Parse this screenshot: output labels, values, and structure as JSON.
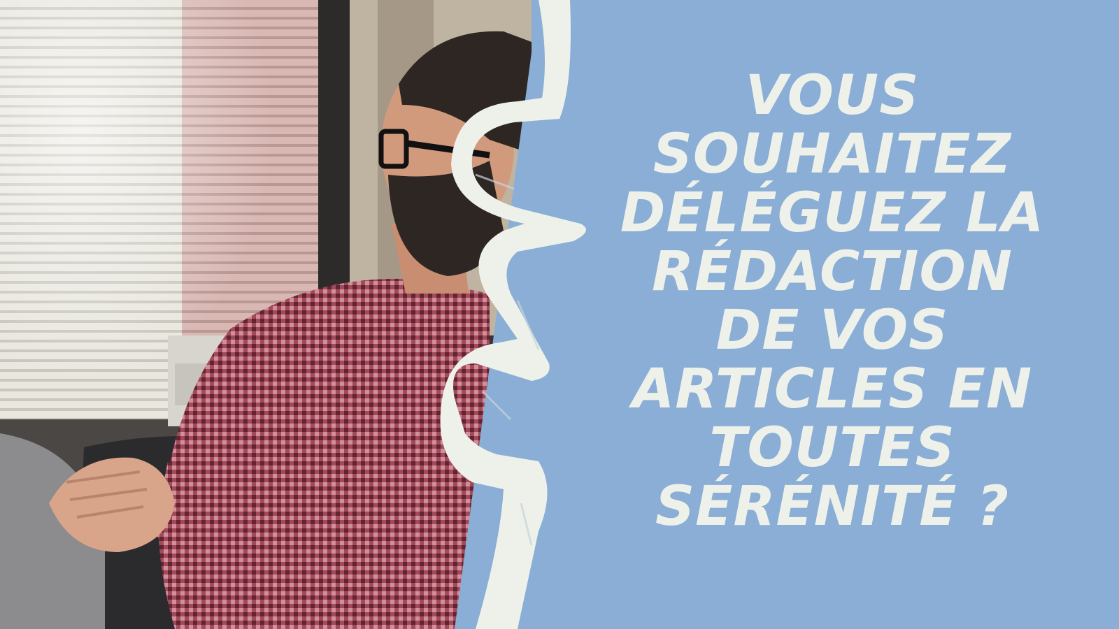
{
  "headline": {
    "lines": [
      "VOUS",
      "SOUHAITEZ",
      "DÉLÉGUEZ LA",
      "RÉDACTION",
      "DE VOS",
      "ARTICLES EN",
      "TOUTES",
      "SÉRÉNITÉ ?"
    ]
  },
  "colors": {
    "panel_background": "#8aaed6",
    "headline_text": "#eef1ea",
    "brush_stroke": "#eef1ea"
  },
  "photo": {
    "subject": "bearded-man-with-glasses-in-checked-shirt-by-window"
  }
}
